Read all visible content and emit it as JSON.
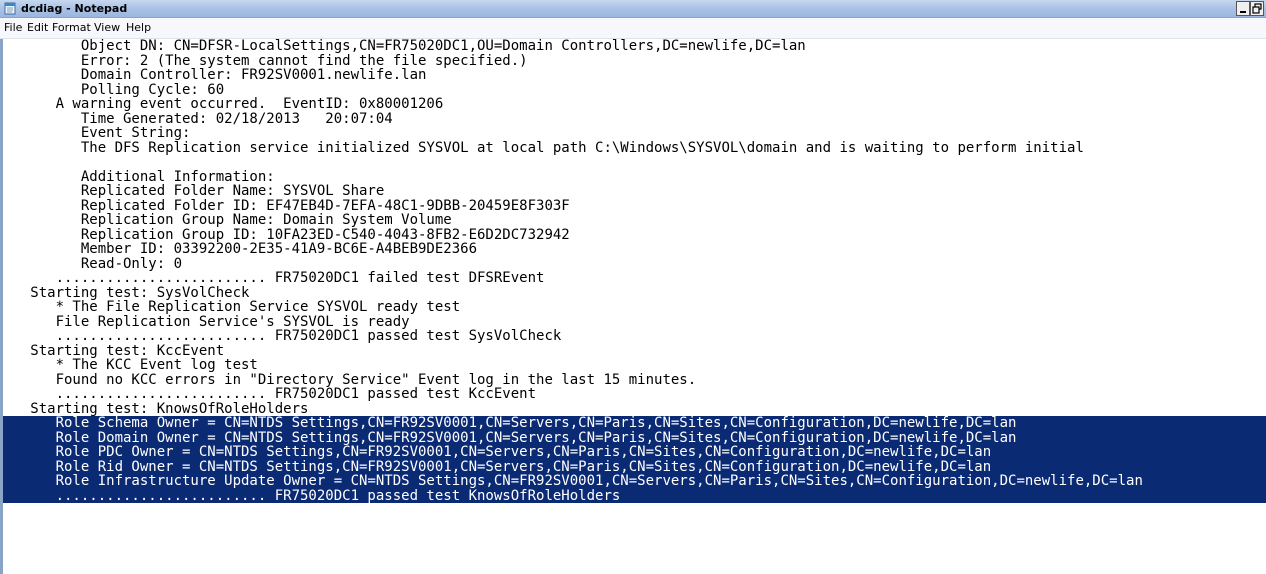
{
  "window": {
    "title": "dcdiag - Notepad"
  },
  "menu": {
    "items": [
      "File",
      "Edit",
      "Format",
      "View",
      "Help"
    ]
  },
  "document": {
    "lines": [
      "         Object DN: CN=DFSR-LocalSettings,CN=FR75020DC1,OU=Domain Controllers,DC=newlife,DC=lan",
      "         Error: 2 (The system cannot find the file specified.)",
      "         Domain Controller: FR92SV0001.newlife.lan",
      "         Polling Cycle: 60",
      "      A warning event occurred.  EventID: 0x80001206",
      "         Time Generated: 02/18/2013   20:07:04",
      "         Event String:",
      "         The DFS Replication service initialized SYSVOL at local path C:\\Windows\\SYSVOL\\domain and is waiting to perform initial",
      "",
      "         Additional Information:",
      "         Replicated Folder Name: SYSVOL Share",
      "         Replicated Folder ID: EF47EB4D-7EFA-48C1-9DBB-20459E8F303F",
      "         Replication Group Name: Domain System Volume",
      "         Replication Group ID: 10FA23ED-C540-4043-8FB2-E6D2DC732942",
      "         Member ID: 03392200-2E35-41A9-BC6E-A4BEB9DE2366",
      "         Read-Only: 0",
      "      ......................... FR75020DC1 failed test DFSREvent",
      "   Starting test: SysVolCheck",
      "      * The File Replication Service SYSVOL ready test",
      "      File Replication Service's SYSVOL is ready",
      "      ......................... FR75020DC1 passed test SysVolCheck",
      "   Starting test: KccEvent",
      "      * The KCC Event log test",
      "      Found no KCC errors in \"Directory Service\" Event log in the last 15 minutes.",
      "      ......................... FR75020DC1 passed test KccEvent",
      "   Starting test: KnowsOfRoleHolders",
      "      Role Schema Owner = CN=NTDS Settings,CN=FR92SV0001,CN=Servers,CN=Paris,CN=Sites,CN=Configuration,DC=newlife,DC=lan",
      "      Role Domain Owner = CN=NTDS Settings,CN=FR92SV0001,CN=Servers,CN=Paris,CN=Sites,CN=Configuration,DC=newlife,DC=lan",
      "      Role PDC Owner = CN=NTDS Settings,CN=FR92SV0001,CN=Servers,CN=Paris,CN=Sites,CN=Configuration,DC=newlife,DC=lan",
      "      Role Rid Owner = CN=NTDS Settings,CN=FR92SV0001,CN=Servers,CN=Paris,CN=Sites,CN=Configuration,DC=newlife,DC=lan",
      "      Role Infrastructure Update Owner = CN=NTDS Settings,CN=FR92SV0001,CN=Servers,CN=Paris,CN=Sites,CN=Configuration,DC=newlife,DC=lan",
      "      ......................... FR75020DC1 passed test KnowsOfRoleHolders"
    ],
    "selected_line_indices": [
      26,
      27,
      28,
      29,
      30,
      31
    ]
  },
  "colors": {
    "selection_background": "#0b2a74",
    "selection_text": "#ffffff",
    "titlebar": "#a9c2e6"
  },
  "icons": {
    "app": "notepad-icon",
    "minimize": "minimize-icon",
    "restore": "restore-icon"
  }
}
